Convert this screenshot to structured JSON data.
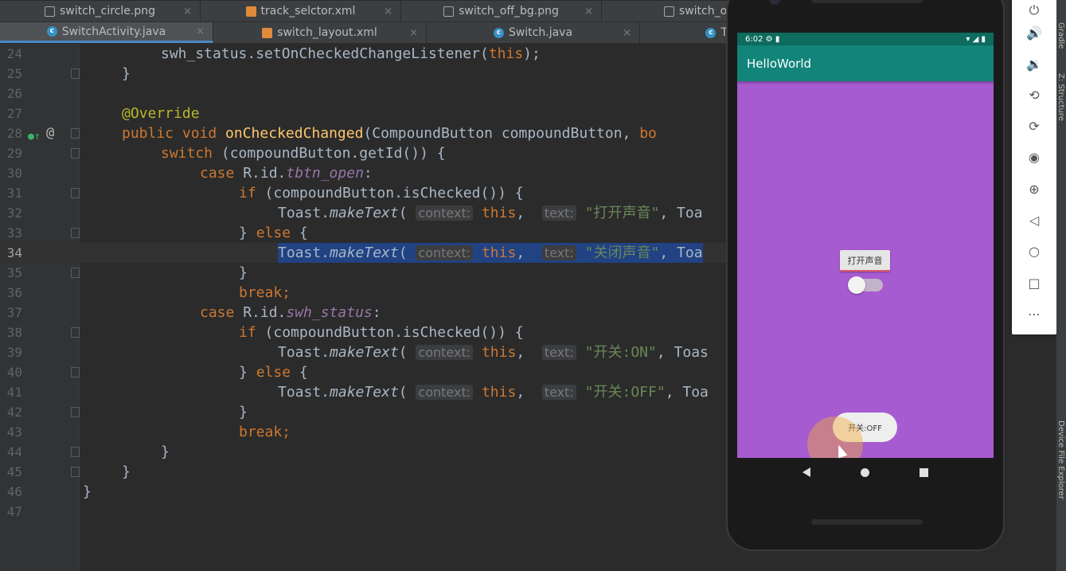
{
  "tabs_row1": [
    {
      "label": "switch_circle.png",
      "icon": "image-file-icon"
    },
    {
      "label": "track_selctor.xml",
      "icon": "xml-file-icon"
    },
    {
      "label": "switch_off_bg.png",
      "icon": "image-file-icon"
    },
    {
      "label": "switch_on_",
      "icon": "image-file-icon"
    }
  ],
  "tabs_row2": [
    {
      "label": "SwitchActivity.java",
      "icon": "java-class-icon",
      "active": true
    },
    {
      "label": "switch_layout.xml",
      "icon": "xml-file-icon"
    },
    {
      "label": "Switch.java",
      "icon": "java-class-icon"
    },
    {
      "label": "ToggleButto",
      "icon": "java-class-icon"
    }
  ],
  "close_glyph": "×",
  "editor": {
    "current_line": "34",
    "lines": [
      {
        "n": "24",
        "t1": "swh_status.setOnCheckedChangeListener(",
        "t2": "this",
        "t3": ");"
      },
      {
        "n": "25",
        "t1": "}"
      },
      {
        "n": "26"
      },
      {
        "n": "27",
        "t1": "@Override"
      },
      {
        "n": "28",
        "t1": "public void ",
        "t2": "onCheckedChanged",
        "t3": "(CompoundButton compoundButton, ",
        "t4": "bo"
      },
      {
        "n": "29",
        "t1": "switch ",
        "t2": "(compoundButton.getId()) {"
      },
      {
        "n": "30",
        "t1": "case ",
        "t2": "R.id.",
        "t3": "tbtn_open",
        "t4": ":"
      },
      {
        "n": "31",
        "t1": "if ",
        "t2": "(compoundButton.isChecked()) {"
      },
      {
        "n": "32",
        "t1": "Toast.",
        "t2": "makeText",
        "t3": "( ",
        "h1": "context:",
        "t4": "this",
        "t5": ",  ",
        "h2": "text:",
        "t6": "\"打开声音\"",
        "t7": ", Toa"
      },
      {
        "n": "33",
        "t1": "} ",
        "t2": "else",
        "t3": " {"
      },
      {
        "n": "34",
        "t1": "Toast.",
        "t2": "makeText",
        "t3": "( ",
        "h1": "context:",
        "t4": "this",
        "t5": ",  ",
        "h2": "text:",
        "t6": "\"关闭声音\"",
        "t7": ", Toa"
      },
      {
        "n": "35",
        "t1": "}"
      },
      {
        "n": "36",
        "t1": "break;"
      },
      {
        "n": "37",
        "t1": "case ",
        "t2": "R.id.",
        "t3": "swh_status",
        "t4": ":"
      },
      {
        "n": "38",
        "t1": "if ",
        "t2": "(compoundButton.isChecked()) {"
      },
      {
        "n": "39",
        "t1": "Toast.",
        "t2": "makeText",
        "t3": "( ",
        "h1": "context:",
        "t4": "this",
        "t5": ",  ",
        "h2": "text:",
        "t6": "\"开关:ON\"",
        "t7": ", Toas"
      },
      {
        "n": "40",
        "t1": "} ",
        "t2": "else",
        "t3": " {"
      },
      {
        "n": "41",
        "t1": "Toast.",
        "t2": "makeText",
        "t3": "( ",
        "h1": "context:",
        "t4": "this",
        "t5": ",  ",
        "h2": "text:",
        "t6": "\"开关:OFF\"",
        "t7": ", Toa"
      },
      {
        "n": "42",
        "t1": "}"
      },
      {
        "n": "43",
        "t1": "break;"
      },
      {
        "n": "44",
        "t1": "}"
      },
      {
        "n": "45",
        "t1": "}"
      },
      {
        "n": "46",
        "t1": "}"
      },
      {
        "n": "47"
      }
    ],
    "gutter_at": "@"
  },
  "phone": {
    "status_time": "6:02",
    "app_title": "HelloWorld",
    "toggle_button_label": "打开声音",
    "switch_checked": false,
    "toast_text": "开关:OFF"
  },
  "emulator_toolbar": [
    "power-icon",
    "volume-up-icon",
    "volume-down-icon",
    "rotate-left-icon",
    "rotate-right-icon",
    "camera-icon",
    "zoom-icon",
    "back-icon",
    "home-icon",
    "overview-icon",
    "more-icon"
  ],
  "side_labels": [
    "Gradle",
    "Z: Structure",
    "Device File Explorer"
  ],
  "colors": {
    "accent": "#128479",
    "screen_bg": "#a75bd1",
    "selection": "#214283"
  }
}
